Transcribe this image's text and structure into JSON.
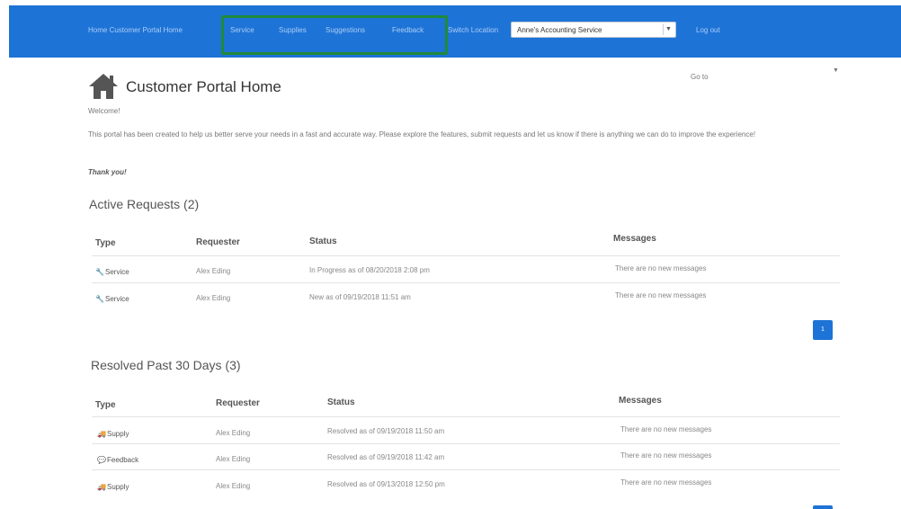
{
  "nav": {
    "brand": "Home Customer Portal Home",
    "links": [
      "Service",
      "Supplies",
      "Suggestions",
      "Feedback"
    ],
    "switch_label": "Switch Location",
    "location_value": "Anne's Accounting Service",
    "logout": "Log out"
  },
  "header": {
    "title": "Customer Portal Home",
    "goto": "Go to",
    "welcome": "Welcome!",
    "intro": "This portal has been created to help us better serve your needs in a fast and accurate way. Please explore the features, submit requests and let us know if there is anything we can do to improve the experience!",
    "thanks": "Thank you!"
  },
  "active": {
    "title": "Active Requests (2)",
    "columns": [
      "Type",
      "Requester",
      "Status",
      "Messages"
    ],
    "rows": [
      {
        "type": "Service",
        "icon": "wrench-icon",
        "requester": "Alex Eding",
        "status": "In Progress as of 08/20/2018 2:08 pm",
        "messages": "There are no new messages"
      },
      {
        "type": "Service",
        "icon": "wrench-icon",
        "requester": "Alex Eding",
        "status": "New as of 09/19/2018 11:51 am",
        "messages": "There are no new messages"
      }
    ],
    "page": "1"
  },
  "resolved": {
    "title": "Resolved Past 30 Days (3)",
    "columns": [
      "Type",
      "Requester",
      "Status",
      "Messages"
    ],
    "rows": [
      {
        "type": "Supply",
        "icon": "truck-icon",
        "requester": "Alex Eding",
        "status": "Resolved as of 09/19/2018 11:50 am",
        "messages": "There are no new messages"
      },
      {
        "type": "Feedback",
        "icon": "comment-icon",
        "requester": "Alex Eding",
        "status": "Resolved as of 09/19/2018 11:42 am",
        "messages": "There are no new messages"
      },
      {
        "type": "Supply",
        "icon": "truck-icon",
        "requester": "Alex Eding",
        "status": "Resolved as of 09/13/2018 12:50 pm",
        "messages": "There are no new messages"
      }
    ]
  },
  "colors": {
    "brand": "#1e73d6",
    "highlight": "#1f8a3b"
  }
}
